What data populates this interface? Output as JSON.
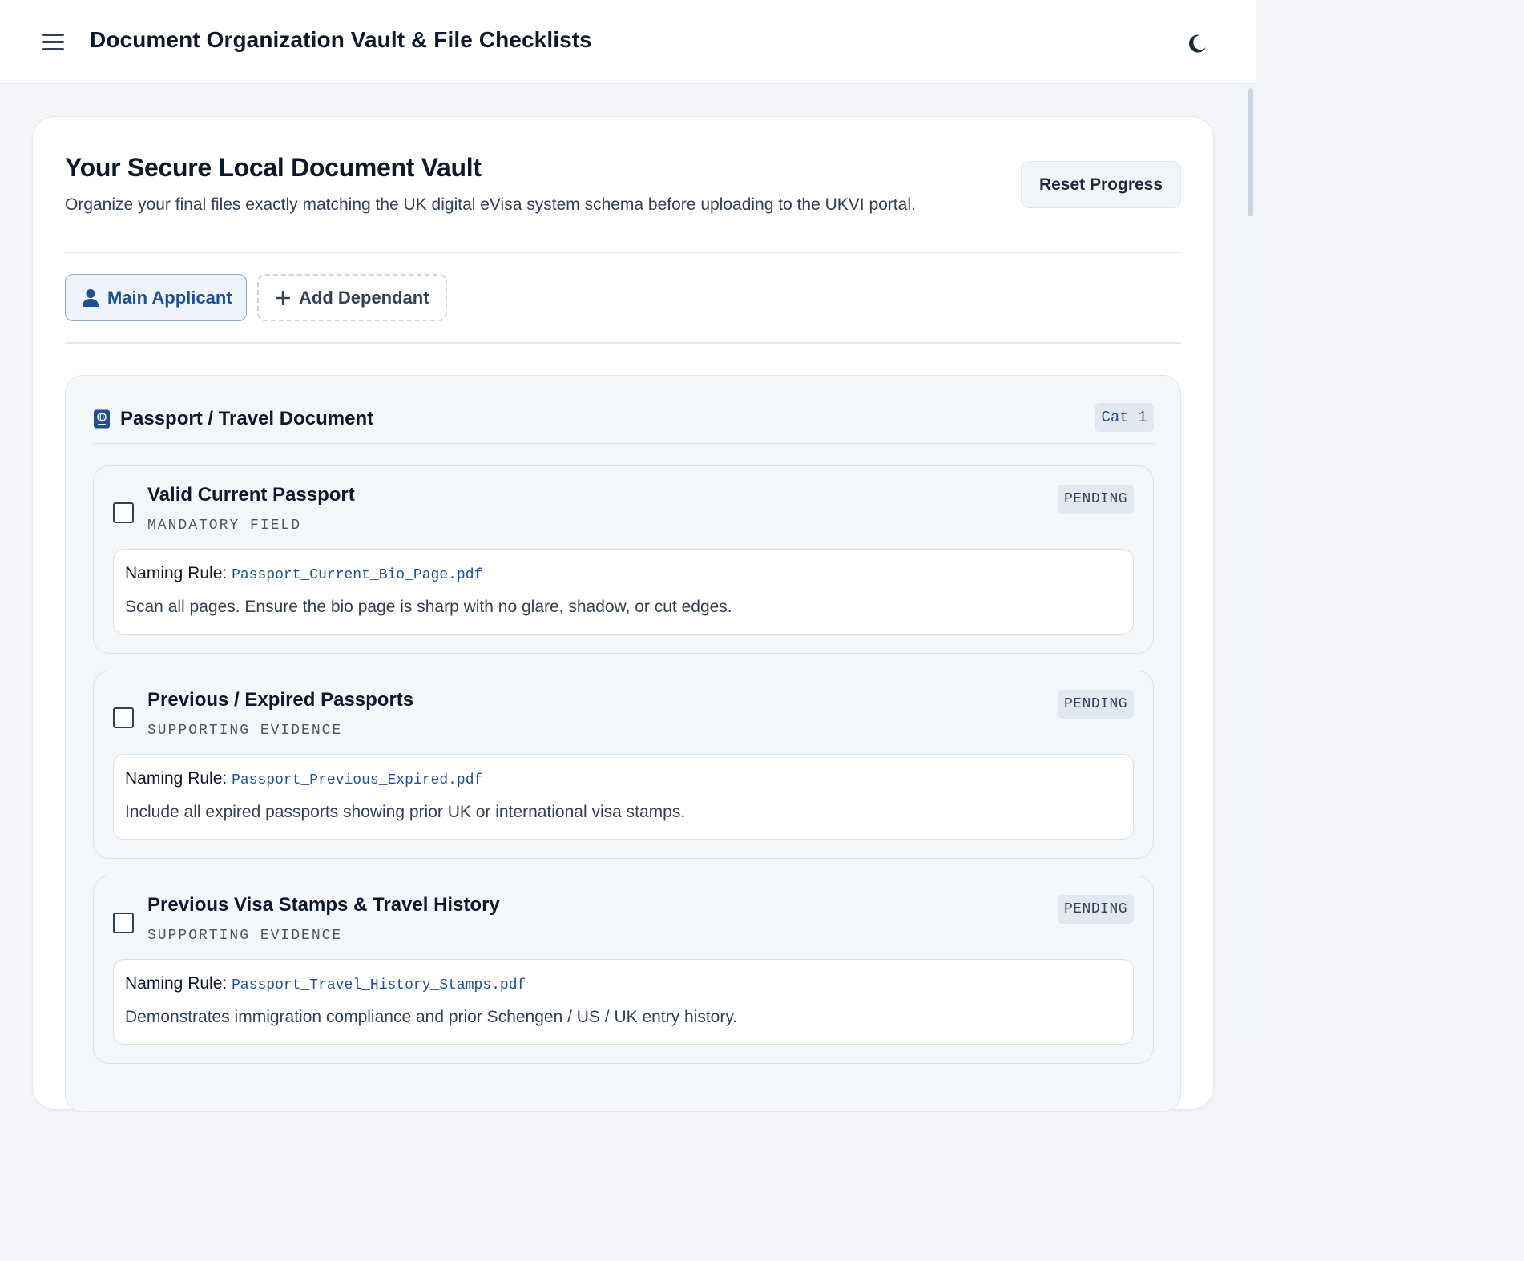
{
  "header": {
    "title": "Document Organization Vault & File Checklists",
    "menu_icon": "hamburger-menu-icon",
    "theme_icon": "moon-icon"
  },
  "vault": {
    "title": "Your Secure Local Document Vault",
    "subtitle": "Organize your final files exactly matching the UK digital eVisa system schema before uploading to the UKVI portal.",
    "reset_label": "Reset Progress"
  },
  "tabs": {
    "main_label": "Main Applicant",
    "add_label": "Add Dependant"
  },
  "category": {
    "title": "Passport / Travel Document",
    "badge": "Cat 1",
    "items": [
      {
        "name": "Valid Current Passport",
        "type": "MANDATORY FIELD",
        "status": "PENDING",
        "rule_label": "Naming Rule:",
        "filename": "Passport_Current_Bio_Page.pdf",
        "description": "Scan all pages. Ensure the bio page is sharp with no glare, shadow, or cut edges."
      },
      {
        "name": "Previous / Expired Passports",
        "type": "SUPPORTING EVIDENCE",
        "status": "PENDING",
        "rule_label": "Naming Rule:",
        "filename": "Passport_Previous_Expired.pdf",
        "description": "Include all expired passports showing prior UK or international visa stamps."
      },
      {
        "name": "Previous Visa Stamps & Travel History",
        "type": "SUPPORTING EVIDENCE",
        "status": "PENDING",
        "rule_label": "Naming Rule:",
        "filename": "Passport_Travel_History_Stamps.pdf",
        "description": "Demonstrates immigration compliance and prior Schengen / US / UK entry history."
      }
    ]
  },
  "colors": {
    "accent": "#1d4f91",
    "background": "#f3f5f8",
    "card": "#ffffff",
    "text": "#0f172a"
  }
}
